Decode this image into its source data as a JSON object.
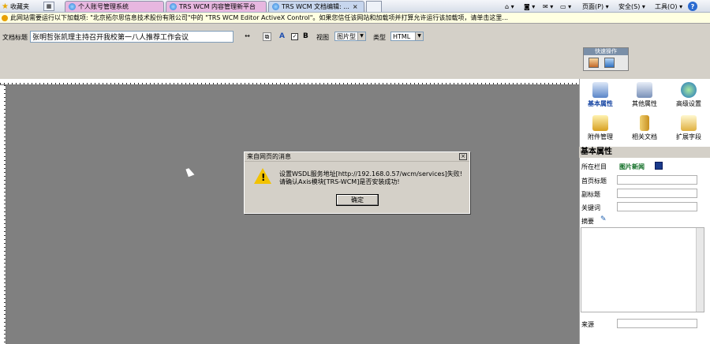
{
  "browser": {
    "favorites_label": "收藏夹",
    "tabs": [
      {
        "label": "个人账号管理系统"
      },
      {
        "label": "TRS WCM 内容管理新平台"
      },
      {
        "label": "TRS WCM 文档编辑: ..."
      }
    ],
    "tab_close": "×",
    "toolbar": {
      "page_label": "页面(P) ▾",
      "safety_label": "安全(S) ▾",
      "tools_label": "工具(O) ▾",
      "help_label": "?"
    }
  },
  "infobar": {
    "message": "此网站需要运行以下加载项: \"北京拓尔思信息技术股份有限公司\"中的 \"TRS WCM Editor ActiveX Control\"。如果您信任该网站和加载项并打算允许运行该加载项，请单击这里..."
  },
  "form": {
    "doc_title_label": "文档标题",
    "doc_title_value": "张明哲张凯理主持召开我校第一八人推荐工作会议",
    "attribute_label": "A",
    "attribute_checked": "✓",
    "bold_label": "B",
    "display_label": "视图",
    "display_value": "图片型",
    "type_label": "类型",
    "type_value": "HTML"
  },
  "groupbox": {
    "title": "快速操作"
  },
  "dialog": {
    "title": "来自网页的消息",
    "close": "×",
    "message": "设置WSDL服务地址[http://192.168.0.57/wcm/services]失败! 请确认Axis模块[TRS-WCM]是否安装成功!",
    "ok_label": "确定"
  },
  "panel": {
    "icons": [
      {
        "label": "基本属性"
      },
      {
        "label": "其他属性"
      },
      {
        "label": "高级设置"
      },
      {
        "label": "附件管理"
      },
      {
        "label": "相关文档"
      },
      {
        "label": "扩展字段"
      }
    ],
    "section_title": "基本属性",
    "fields": {
      "column_label": "所在栏目",
      "column_value": "图片新闻",
      "headline_label": "首页标题",
      "subtitle_label": "副标题",
      "keywords_label": "关键词",
      "abstract_label": "摘要",
      "source_label": "来源"
    }
  },
  "colors": {
    "canvas": "#808080",
    "tab_pink": "#e7b7e0",
    "infobar": "#ffffe1",
    "warning": "#f2c200"
  }
}
